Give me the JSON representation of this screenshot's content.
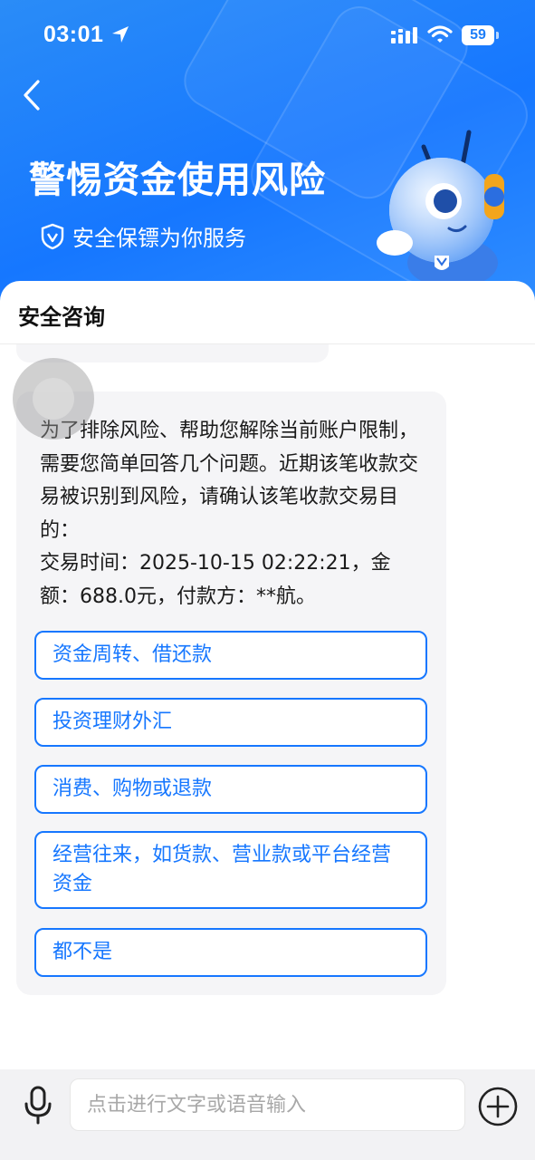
{
  "status_bar": {
    "time": "03:01",
    "battery": "59"
  },
  "header": {
    "title": "警惕资金使用风险",
    "subtitle": "安全保镖为你服务"
  },
  "panel": {
    "title": "安全咨询"
  },
  "message": {
    "text": "为了排除风险、帮助您解除当前账户限制，需要您简单回答几个问题。近期该笔收款交易被识别到风险，请确认该笔收款交易目的：",
    "detail": "交易时间：2025-10-15 02:22:21，金额：688.0元，付款方：**航。"
  },
  "options": [
    {
      "label": "资金周转、借还款"
    },
    {
      "label": "投资理财外汇"
    },
    {
      "label": "消费、购物或退款"
    },
    {
      "label": "经营往来，如货款、营业款或平台经营资金"
    },
    {
      "label": "都不是"
    }
  ],
  "input": {
    "placeholder": "点击进行文字或语音输入"
  },
  "colors": {
    "brand_blue": "#1677ff",
    "header_gradient_start": "#2a8cf7"
  },
  "icons": [
    "location-arrow-icon",
    "signal-icon",
    "wifi-icon",
    "back-chevron-icon",
    "shield-check-icon",
    "mascot-robot",
    "microphone-icon",
    "plus-circle-icon"
  ]
}
